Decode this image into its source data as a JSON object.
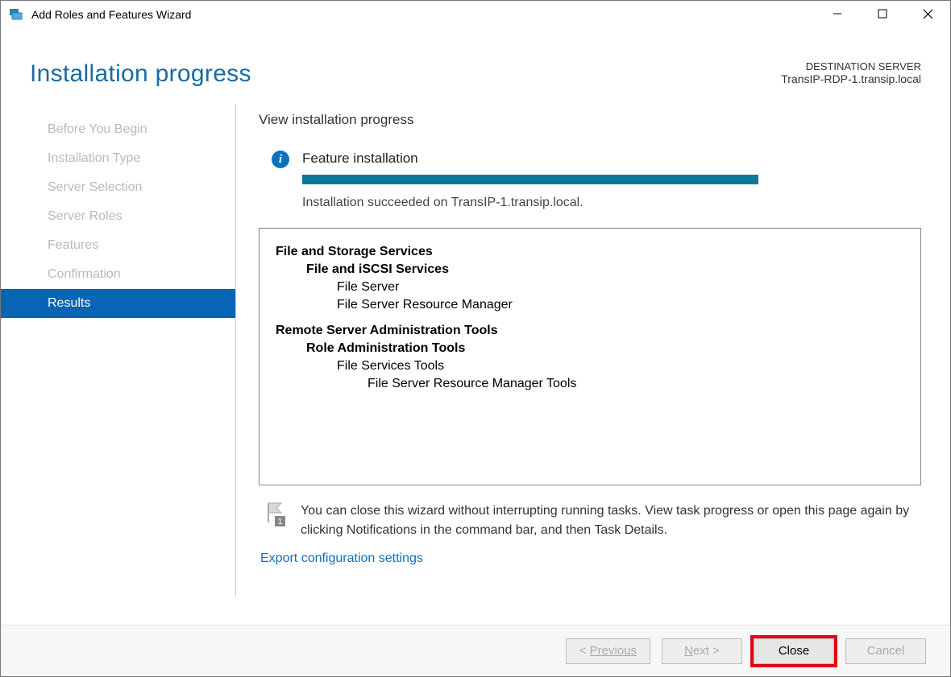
{
  "window": {
    "title": "Add Roles and Features Wizard"
  },
  "header": {
    "page_title": "Installation progress",
    "destination_label": "DESTINATION SERVER",
    "destination_value": "TransIP-RDP-1.transip.local"
  },
  "sidebar": {
    "items": [
      {
        "label": "Before You Begin",
        "active": false
      },
      {
        "label": "Installation Type",
        "active": false
      },
      {
        "label": "Server Selection",
        "active": false
      },
      {
        "label": "Server Roles",
        "active": false
      },
      {
        "label": "Features",
        "active": false
      },
      {
        "label": "Confirmation",
        "active": false
      },
      {
        "label": "Results",
        "active": true
      }
    ]
  },
  "main": {
    "subheading": "View installation progress",
    "status_title": "Feature installation",
    "status_message": "Installation succeeded on TransIP-1.transip.local.",
    "progress_percent": 100
  },
  "tree": [
    {
      "level": 0,
      "text": "File and Storage Services"
    },
    {
      "level": 1,
      "text": "File and iSCSI Services"
    },
    {
      "level": 2,
      "text": "File Server"
    },
    {
      "level": 2,
      "text": "File Server Resource Manager"
    },
    {
      "level": 0,
      "text": "Remote Server Administration Tools"
    },
    {
      "level": 1,
      "text": "Role Administration Tools"
    },
    {
      "level": 2,
      "text": "File Services Tools"
    },
    {
      "level": 3,
      "text": "File Server Resource Manager Tools"
    }
  ],
  "hint": {
    "text": "You can close this wizard without interrupting running tasks. View task progress or open this page again by clicking Notifications in the command bar, and then Task Details."
  },
  "export_link": "Export configuration settings",
  "footer": {
    "previous": "Previous",
    "next": "Next >",
    "close": "Close",
    "cancel": "Cancel"
  }
}
